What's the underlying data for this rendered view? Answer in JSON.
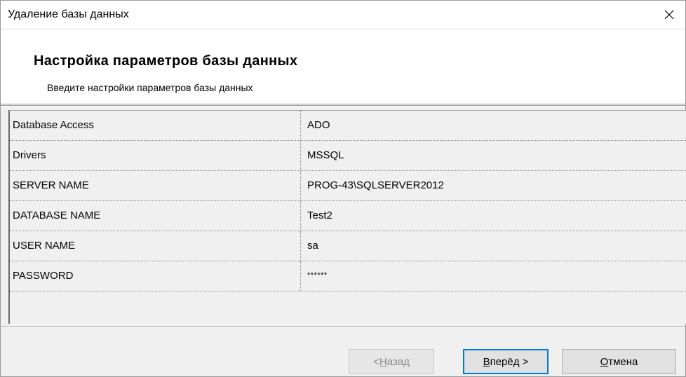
{
  "window": {
    "title": "Удаление базы данных",
    "close_icon": "close-icon"
  },
  "header": {
    "title": "Настройка параметров базы данных",
    "subtitle": "Введите настройки параметров базы данных"
  },
  "grid": {
    "rows": [
      {
        "name": "Database Access",
        "value": "ADO"
      },
      {
        "name": "Drivers",
        "value": "MSSQL"
      },
      {
        "name": "SERVER NAME",
        "value": "PROG-43\\SQLSERVER2012"
      },
      {
        "name": "DATABASE NAME",
        "value": "Test2"
      },
      {
        "name": "USER NAME",
        "value": "sa"
      },
      {
        "name": "PASSWORD",
        "value": "******"
      }
    ]
  },
  "buttons": {
    "back_prefix": "< ",
    "back_accel": "Н",
    "back_rest": "азад",
    "next_accel": "В",
    "next_rest": "перёд >",
    "cancel_accel": "О",
    "cancel_rest": "тмена"
  },
  "colors": {
    "focus_border": "#0078d7",
    "disabled_text": "#8a8a8a"
  }
}
